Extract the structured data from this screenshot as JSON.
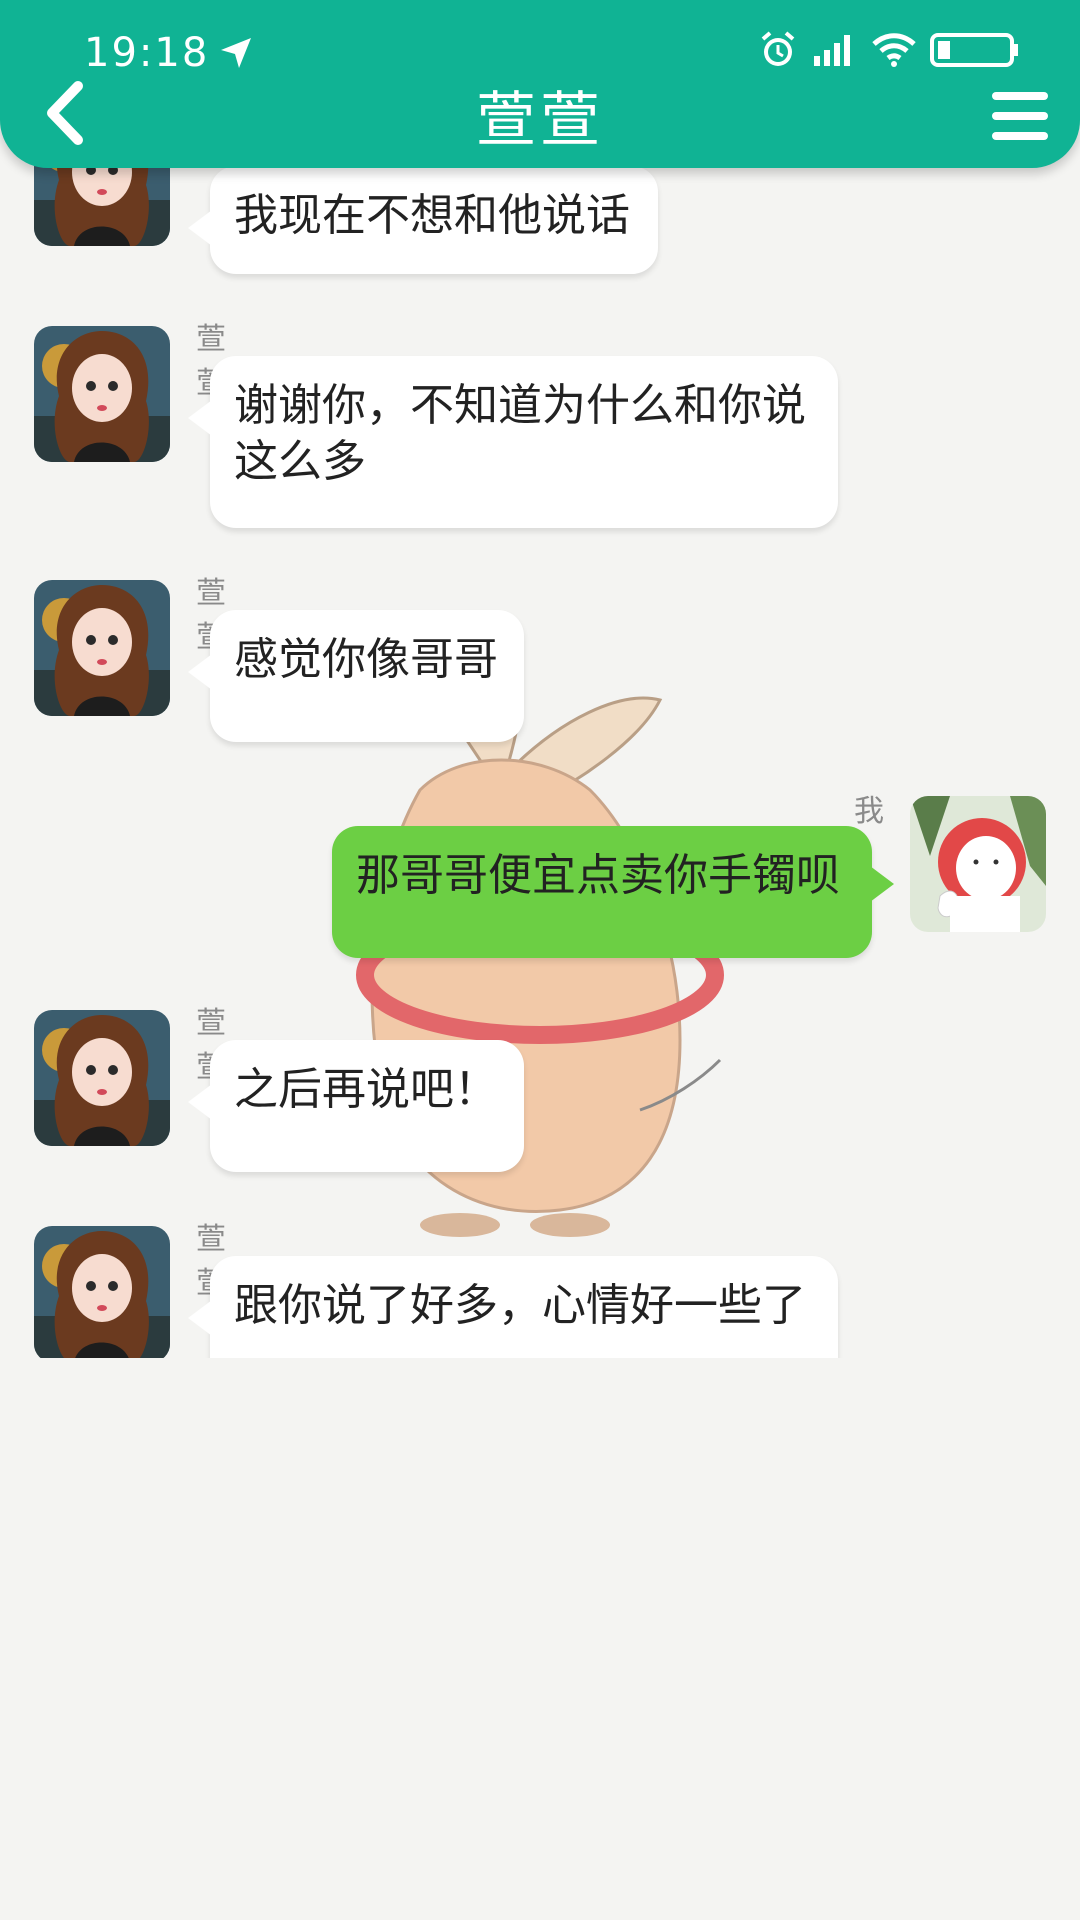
{
  "status_bar": {
    "time": "19:18"
  },
  "header": {
    "title": "萱萱"
  },
  "messages": [
    {
      "sender": "",
      "text": "我现在不想和他说话"
    },
    {
      "sender": "萱萱",
      "text": "谢谢你，不知道为什么和你说这么多"
    },
    {
      "sender": "萱萱",
      "text": "感觉你像哥哥"
    },
    {
      "sender": "我",
      "text": "那哥哥便宜点卖你手镯呗"
    },
    {
      "sender": "萱萱",
      "text": "之后再说吧！"
    },
    {
      "sender": "萱萱",
      "text": "跟你说了好多，心情好一些了"
    }
  ],
  "icons": [
    "location-arrow-icon",
    "alarm-icon",
    "signal-icon",
    "wifi-icon",
    "battery-icon",
    "back-chevron-icon",
    "menu-icon"
  ],
  "colors": {
    "header": "#10b394",
    "my_bubble": "#6ccf44",
    "other_bubble": "#ffffff",
    "background": "#f4f4f2"
  }
}
